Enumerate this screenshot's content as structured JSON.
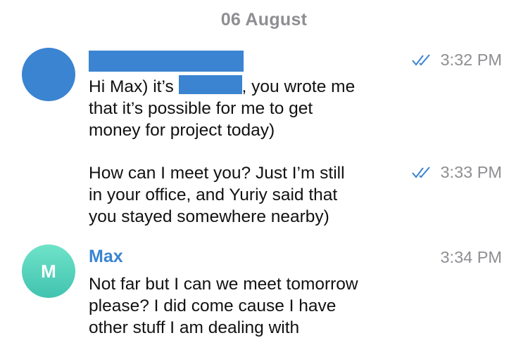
{
  "date_header": "06 August",
  "messages": [
    {
      "lines": [
        [
          "Hi Max) it’s ",
          ", you wrote me"
        ],
        "that it’s possible for me to get",
        "money for project today)"
      ],
      "time": "3:32 PM",
      "status": "read-double-check"
    },
    {
      "lines": [
        "How can I meet you? Just I’m still",
        "in your office, and Yuriy said that",
        "you stayed somewhere nearby)"
      ],
      "time": "3:33 PM",
      "status": "read-double-check"
    },
    {
      "sender": "Max",
      "avatar_initial": "M",
      "lines": [
        "Not far but I can we meet tomorrow",
        "please? I did come cause I have",
        "other stuff I am dealing with"
      ],
      "time": "3:34 PM"
    }
  ],
  "colors": {
    "accent": "#3a84d1",
    "timestamp": "#8e8e93",
    "avatar_teal": "#41c3b0"
  }
}
